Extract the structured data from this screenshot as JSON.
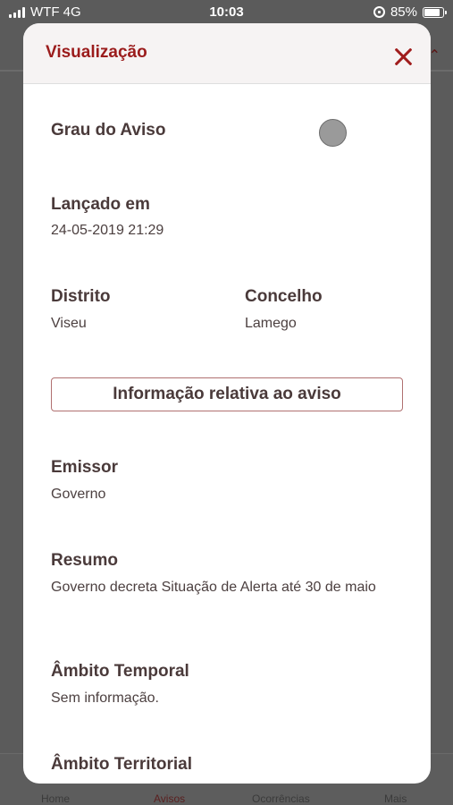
{
  "status_bar": {
    "carrier": "WTF 4G",
    "time": "10:03",
    "battery": "85%",
    "battery_level": 0.85
  },
  "tab_bar": {
    "items": [
      {
        "label": "Home"
      },
      {
        "label": "Avisos"
      },
      {
        "label": "Ocorrências"
      },
      {
        "label": "Mais"
      }
    ],
    "active": "Avisos"
  },
  "modal": {
    "title": "Visualização",
    "grau": {
      "label": "Grau do Aviso",
      "color": "#9a9a9a"
    },
    "lancado": {
      "label": "Lançado em",
      "value": "24-05-2019 21:29"
    },
    "distrito": {
      "label": "Distrito",
      "value": "Viseu"
    },
    "concelho": {
      "label": "Concelho",
      "value": "Lamego"
    },
    "info_button": "Informação relativa ao aviso",
    "emissor": {
      "label": "Emissor",
      "value": "Governo"
    },
    "resumo": {
      "label": "Resumo",
      "value": "Governo decreta Situação de Alerta até 30 de maio"
    },
    "ambito_temporal": {
      "label": "Âmbito Temporal",
      "value": "Sem informação."
    },
    "ambito_territorial": {
      "label": "Âmbito Territorial"
    }
  },
  "colors": {
    "accent": "#9b1c1c",
    "overlay": "#5b5b5b"
  }
}
